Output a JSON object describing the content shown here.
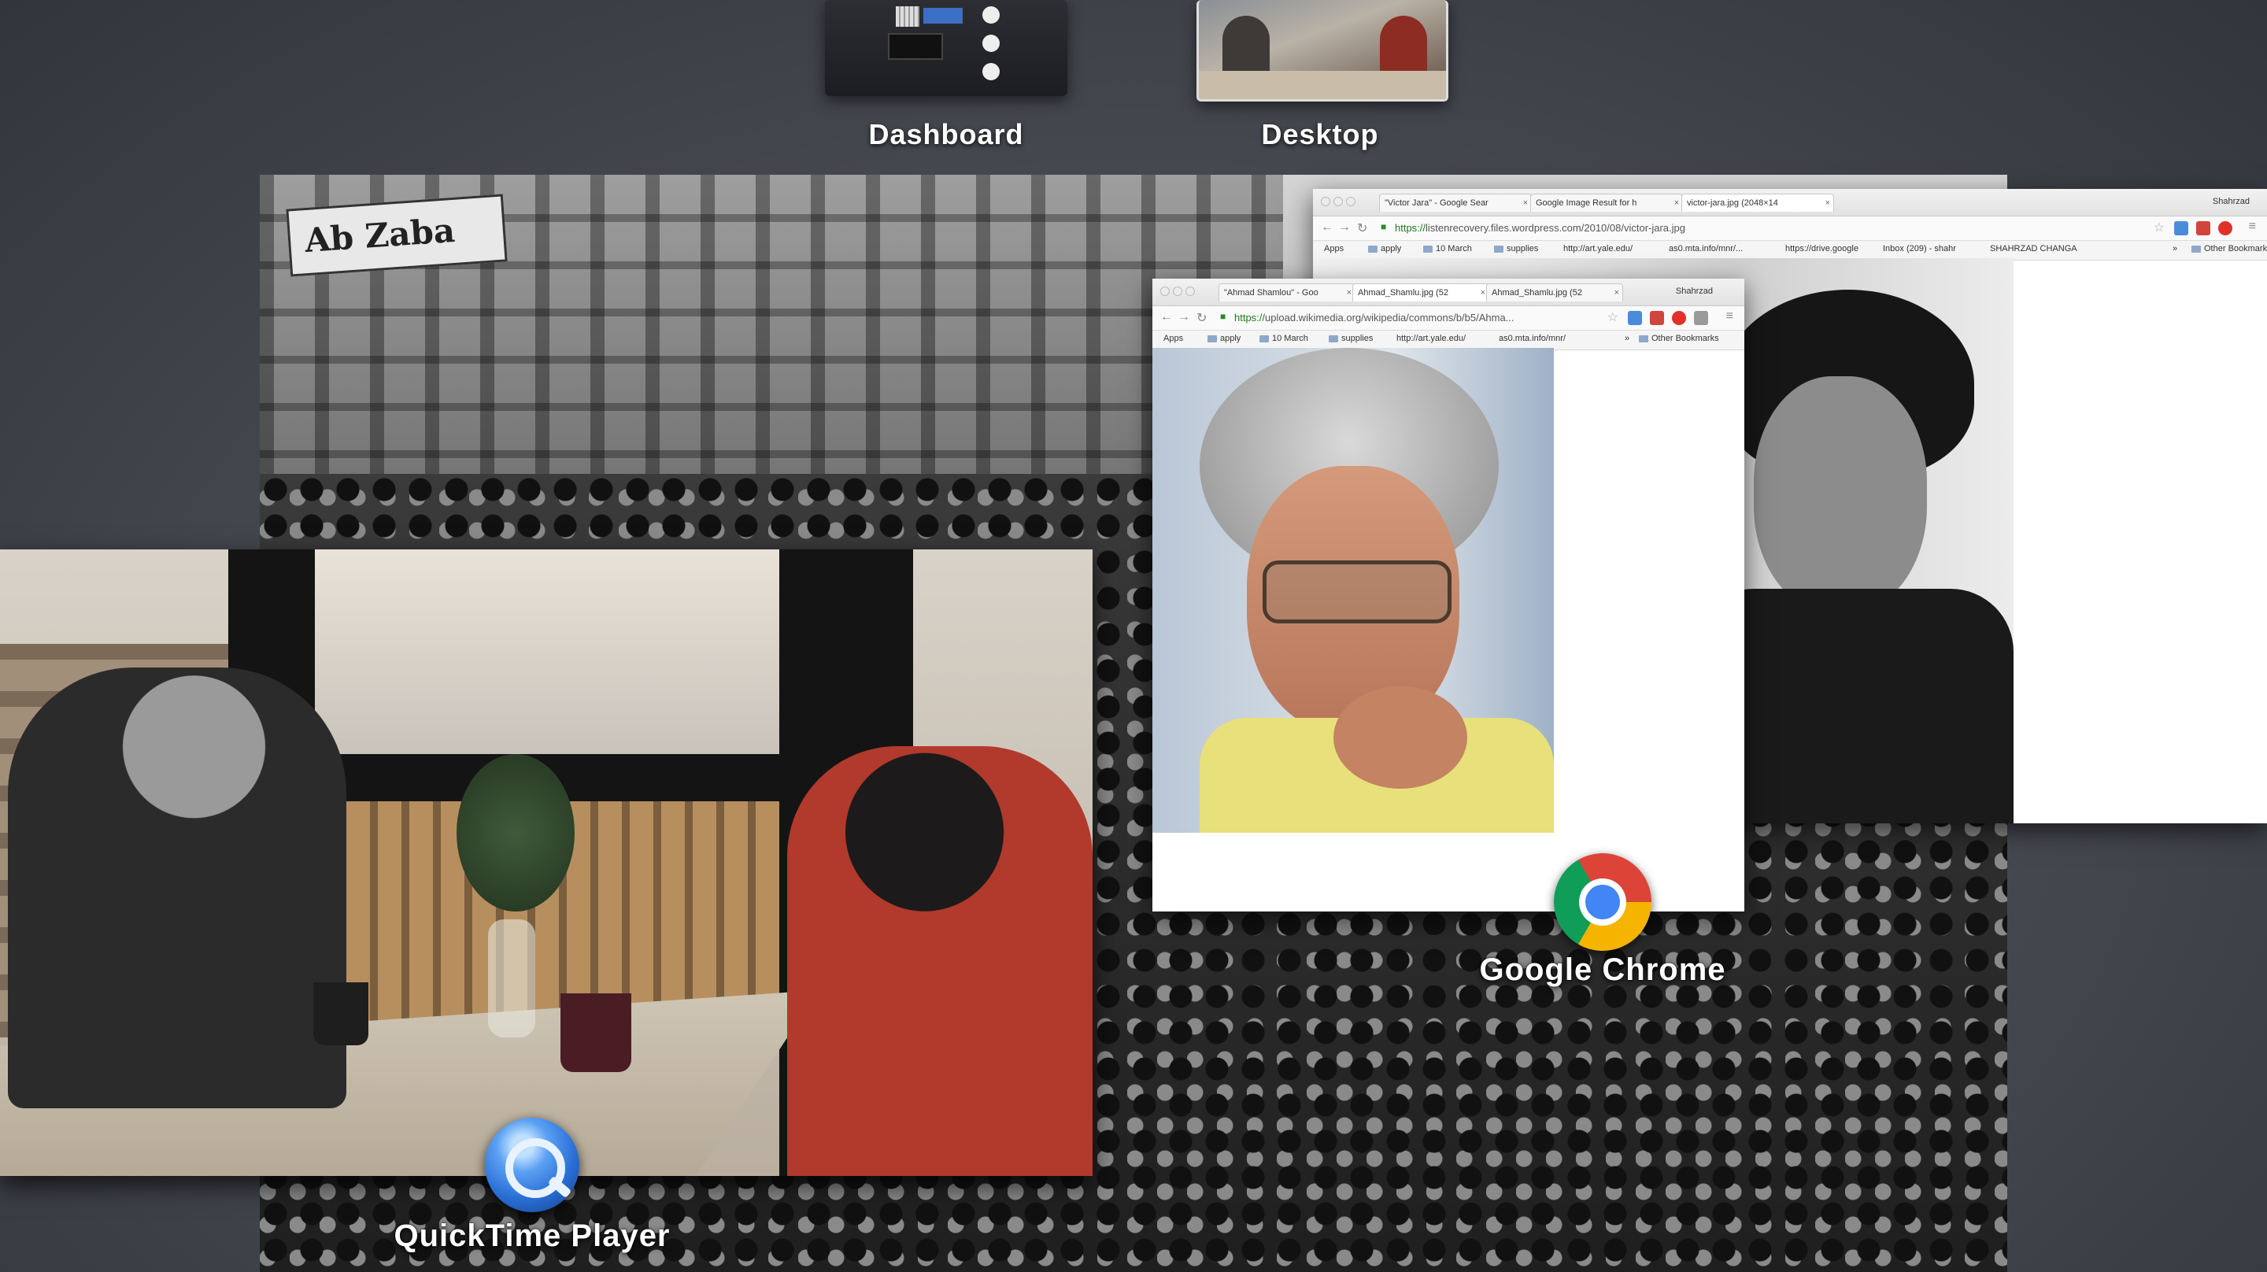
{
  "spaces": {
    "dashboard": {
      "label": "Dashboard"
    },
    "desktop": {
      "label": "Desktop"
    }
  },
  "apps": {
    "chrome": {
      "label": "Google Chrome",
      "icon": "chrome-icon"
    },
    "quicktime": {
      "label": "QuickTime Player",
      "icon": "quicktime-icon"
    }
  },
  "chrome_window_back": {
    "tabs": [
      {
        "label": "\"Victor Jara\" - Google Sear",
        "close": "×"
      },
      {
        "label": "Google Image Result for h",
        "close": "×"
      },
      {
        "label": "victor-jara.jpg (2048×14",
        "close": "×"
      }
    ],
    "user": "Shahrzad",
    "url_scheme": "https://",
    "url_host": "listenrecovery.files.wordpress.com",
    "url_path": "/2010/08/victor-jara.jpg",
    "bookmarks": [
      "Apps",
      "apply",
      "10 March",
      "supplies",
      "http://art.yale.edu/",
      "as0.mta.info/mnr/...",
      "https://drive.google",
      "Inbox (209) - shahr",
      "SHAHRZAD CHANGA",
      "»",
      "Other Bookmarks"
    ]
  },
  "chrome_window_front": {
    "tabs": [
      {
        "label": "\"Ahmad Shamlou\" - Goo",
        "close": "×"
      },
      {
        "label": "Ahmad_Shamlu.jpg (52",
        "close": "×"
      },
      {
        "label": "Ahmad_Shamlu.jpg (52",
        "close": "×"
      }
    ],
    "user": "Shahrzad",
    "url_scheme": "https://",
    "url_host": "upload.wikimedia.org",
    "url_path": "/wikipedia/commons/b/b5/Ahma...",
    "bookmarks": [
      "Apps",
      "apply",
      "10 March",
      "supplies",
      "http://art.yale.edu/",
      "as0.mta.info/mnr/",
      "»",
      "Other Bookmarks"
    ]
  },
  "desktop_photo_sign": "Ab Zaba",
  "colors": {
    "background": "#45484f",
    "chrome_red": "#db4437",
    "chrome_yellow": "#f4b400",
    "chrome_green": "#0f9d58",
    "chrome_blue": "#4285f4",
    "quicktime_blue": "#2a6fd6"
  }
}
